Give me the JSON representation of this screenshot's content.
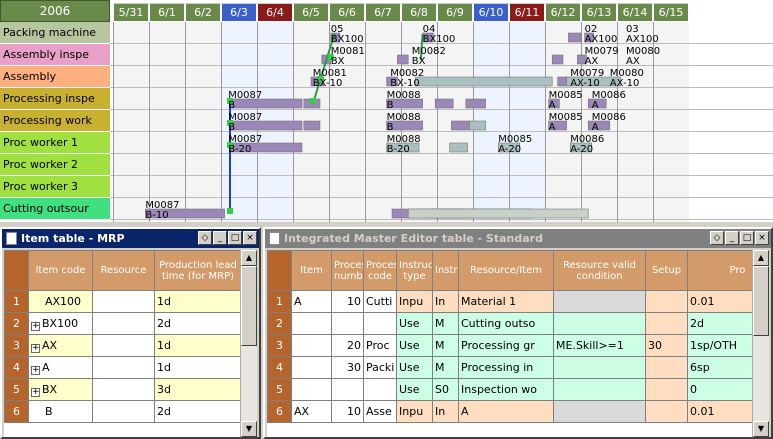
{
  "gantt": {
    "year": "2006",
    "dates": [
      {
        "label": "5/31",
        "color": "#6a8a4c"
      },
      {
        "label": "6/1",
        "color": "#6a8a4c"
      },
      {
        "label": "6/2",
        "color": "#6a8a4c"
      },
      {
        "label": "6/3",
        "color": "#3a5fc9"
      },
      {
        "label": "6/4",
        "color": "#8b1a1a"
      },
      {
        "label": "6/5",
        "color": "#6a8a4c"
      },
      {
        "label": "6/6",
        "color": "#6a8a4c"
      },
      {
        "label": "6/7",
        "color": "#6a8a4c"
      },
      {
        "label": "6/8",
        "color": "#6a8a4c"
      },
      {
        "label": "6/9",
        "color": "#6a8a4c"
      },
      {
        "label": "6/10",
        "color": "#3a5fc9"
      },
      {
        "label": "6/11",
        "color": "#8b1a1a"
      },
      {
        "label": "6/12",
        "color": "#6a8a4c"
      },
      {
        "label": "6/13",
        "color": "#6a8a4c"
      },
      {
        "label": "6/14",
        "color": "#6a8a4c"
      },
      {
        "label": "6/15",
        "color": "#6a8a4c"
      }
    ],
    "rows": [
      {
        "label": "Packing machine",
        "color": "#b8c6a0"
      },
      {
        "label": "Assembly inspe",
        "color": "#e8a0c8"
      },
      {
        "label": "Assembly",
        "color": "#ffb080"
      },
      {
        "label": "Processing inspe",
        "color": "#c8b030"
      },
      {
        "label": "Processing work",
        "color": "#c8b030"
      },
      {
        "label": "Proc worker 1",
        "color": "#a0e040"
      },
      {
        "label": "Proc worker 2",
        "color": "#a0e040"
      },
      {
        "label": "Proc worker 3",
        "color": "#a0e040"
      },
      {
        "label": "Cutting outsour",
        "color": "#40e080"
      }
    ],
    "bar_labels": [
      {
        "row": 0,
        "day": 6.05,
        "l1": "05",
        "l2": "BX100"
      },
      {
        "row": 0,
        "day": 8.6,
        "l1": "04",
        "l2": "BX100"
      },
      {
        "row": 0,
        "day": 13.1,
        "l1": "02",
        "l2": "AX100"
      },
      {
        "row": 0,
        "day": 14.25,
        "l1": "03",
        "l2": "AX100"
      },
      {
        "row": 1,
        "day": 6.05,
        "l1": "M0081",
        "l2": "BX"
      },
      {
        "row": 1,
        "day": 8.3,
        "l1": "M0082",
        "l2": "BX"
      },
      {
        "row": 1,
        "day": 13.1,
        "l1": "M0079",
        "l2": "AX"
      },
      {
        "row": 1,
        "day": 14.25,
        "l1": "M0080",
        "l2": "AX"
      },
      {
        "row": 2,
        "day": 5.55,
        "l1": "M0081",
        "l2": "BX-10"
      },
      {
        "row": 2,
        "day": 7.7,
        "l1": "M0082",
        "l2": "BX-10"
      },
      {
        "row": 2,
        "day": 12.7,
        "l1": "M0079",
        "l2": "AX-10"
      },
      {
        "row": 2,
        "day": 13.8,
        "l1": "M0080",
        "l2": "AX-10"
      },
      {
        "row": 3,
        "day": 3.2,
        "l1": "M0087",
        "l2": "B"
      },
      {
        "row": 3,
        "day": 7.6,
        "l1": "M0088",
        "l2": "B"
      },
      {
        "row": 3,
        "day": 12.1,
        "l1": "M0085",
        "l2": "A"
      },
      {
        "row": 3,
        "day": 13.3,
        "l1": "M0086",
        "l2": "A"
      },
      {
        "row": 4,
        "day": 3.2,
        "l1": "M0087",
        "l2": "B"
      },
      {
        "row": 4,
        "day": 7.6,
        "l1": "M0088",
        "l2": "B"
      },
      {
        "row": 4,
        "day": 12.1,
        "l1": "M0085",
        "l2": "A"
      },
      {
        "row": 4,
        "day": 13.3,
        "l1": "M0086",
        "l2": "A"
      },
      {
        "row": 5,
        "day": 3.2,
        "l1": "M0087",
        "l2": "B-20"
      },
      {
        "row": 5,
        "day": 7.6,
        "l1": "M0088",
        "l2": "B-20"
      },
      {
        "row": 5,
        "day": 10.7,
        "l1": "M0085",
        "l2": "A-20"
      },
      {
        "row": 5,
        "day": 12.7,
        "l1": "M0086",
        "l2": "A-20"
      },
      {
        "row": 8,
        "day": 0.9,
        "l1": "M0087",
        "l2": "B-10"
      }
    ]
  },
  "mrp": {
    "title": "Item table - MRP",
    "headers": [
      "Item code",
      "Resource",
      "Production lead time (for MRP)"
    ],
    "rows": [
      {
        "n": "1",
        "code": "AX100",
        "plus": false,
        "res": "",
        "lt": "1d",
        "color": "yellow"
      },
      {
        "n": "2",
        "code": "BX100",
        "plus": true,
        "res": "",
        "lt": "2d",
        "color": "white"
      },
      {
        "n": "3",
        "code": "AX",
        "plus": true,
        "res": "",
        "lt": "1d",
        "color": "yellow"
      },
      {
        "n": "4",
        "code": "A",
        "plus": true,
        "res": "",
        "lt": "1d",
        "color": "white"
      },
      {
        "n": "5",
        "code": "BX",
        "plus": true,
        "res": "",
        "lt": "3d",
        "color": "yellow"
      },
      {
        "n": "6",
        "code": "B",
        "plus": false,
        "res": "",
        "lt": "2d",
        "color": "white"
      }
    ]
  },
  "ime": {
    "title": "Integrated Master Editor table - Standard",
    "headers": [
      "Item",
      "Process number",
      "Process code",
      "Instruction type",
      "Instruction",
      "Resource/Item",
      "Resource valid condition",
      "Setup",
      "Pro"
    ],
    "rows": [
      {
        "n": "1",
        "item": "A",
        "pnum": "10",
        "pcode": "Cutti",
        "itype": "Inpu",
        "instr": "In",
        "res": "Material 1",
        "cond": "",
        "setup": "",
        "pro": "0.01",
        "color": "peach"
      },
      {
        "n": "2",
        "item": "",
        "pnum": "",
        "pcode": "",
        "itype": "Use",
        "instr": "M",
        "res": "Cutting outso",
        "cond": "",
        "setup": "",
        "pro": "2d",
        "color": "mint"
      },
      {
        "n": "3",
        "item": "",
        "pnum": "20",
        "pcode": "Proc",
        "itype": "Use",
        "instr": "M",
        "res": "Processing gr",
        "cond": "ME.Skill>=1",
        "setup": "30",
        "pro": "1sp/OTH",
        "color": "mint"
      },
      {
        "n": "4",
        "item": "",
        "pnum": "30",
        "pcode": "Packi",
        "itype": "Use",
        "instr": "M",
        "res": "Processing in",
        "cond": "",
        "setup": "",
        "pro": "6sp",
        "color": "mint"
      },
      {
        "n": "5",
        "item": "",
        "pnum": "",
        "pcode": "",
        "itype": "Use",
        "instr": "S0",
        "res": "Inspection wo",
        "cond": "",
        "setup": "",
        "pro": "0",
        "color": "mint"
      },
      {
        "n": "6",
        "item": "AX",
        "pnum": "10",
        "pcode": "Asse",
        "itype": "Inpu",
        "instr": "In",
        "res": "A",
        "cond": "",
        "setup": "",
        "pro": "0.01",
        "color": "peach"
      }
    ]
  },
  "window_buttons": {
    "restore": "◇",
    "minimize": "_",
    "maximize": "□",
    "close": "×"
  },
  "colors": {
    "titlebar_active": "#0a246a",
    "titlebar_inactive": "#808080"
  }
}
